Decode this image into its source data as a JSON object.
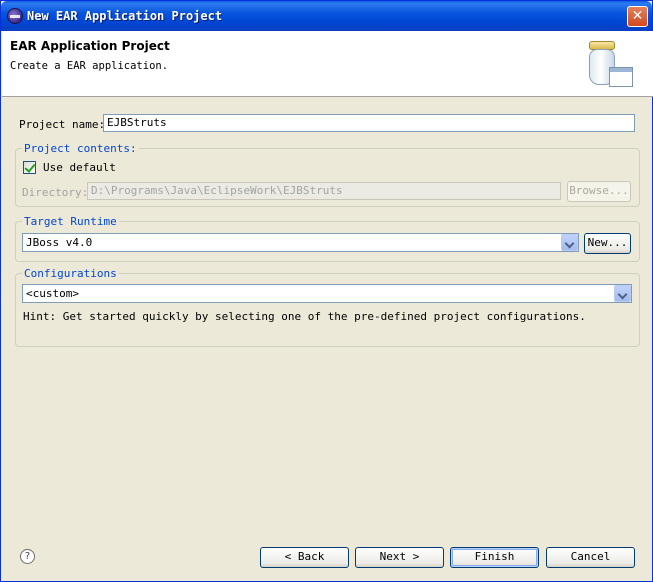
{
  "window": {
    "title": "New EAR Application Project",
    "close_glyph": "✕"
  },
  "banner": {
    "title": "EAR Application Project",
    "description": "Create a EAR application."
  },
  "project_name": {
    "label": "Project name:",
    "value": "EJBStruts"
  },
  "project_contents": {
    "title": "Project contents:",
    "use_default_label": "Use default",
    "use_default_checked": true,
    "directory_label": "Directory:",
    "directory_value": "D:\\Programs\\Java\\EclipseWork\\EJBStruts",
    "browse_label": "Browse..."
  },
  "target_runtime": {
    "title": "Target Runtime",
    "selected": "JBoss v4.0",
    "new_label": "New..."
  },
  "configurations": {
    "title": "Configurations",
    "selected": "<custom>",
    "hint": "Hint: Get started quickly by selecting one of the pre-defined project configurations."
  },
  "footer": {
    "help_glyph": "?",
    "back_label": "< Back",
    "next_label": "Next >",
    "finish_label": "Finish",
    "cancel_label": "Cancel"
  }
}
